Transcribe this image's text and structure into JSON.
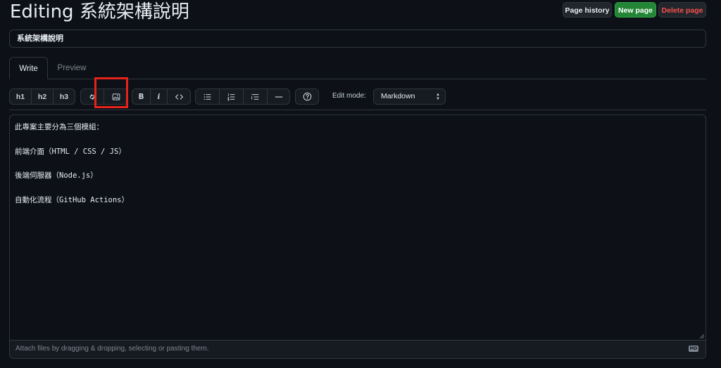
{
  "page": {
    "title": "Editing 系統架構說明"
  },
  "header_buttons": {
    "history": "Page history",
    "new": "New page",
    "delete": "Delete page"
  },
  "title_input": {
    "value": "系統架構說明"
  },
  "tabs": {
    "write": "Write",
    "preview": "Preview"
  },
  "toolbar": {
    "h1": "h1",
    "h2": "h2",
    "h3": "h3",
    "bold": "B",
    "italic": "i",
    "icons": [
      "link-icon",
      "image-icon",
      "code-icon",
      "unordered-list-icon",
      "ordered-list-icon",
      "task-list-icon",
      "horizontal-rule-icon",
      "help-icon"
    ]
  },
  "edit_mode": {
    "label": "Edit mode:",
    "selected": "Markdown"
  },
  "editor": {
    "lines": [
      "此專案主要分為三個模組：",
      "",
      "前端介面（HTML / CSS / JS）",
      "",
      "後端伺服器（Node.js）",
      "",
      "自動化流程（GitHub Actions）"
    ],
    "attach_hint": "Attach files by dragging & dropping, selecting or pasting them.",
    "md_badge": "MD"
  },
  "colors": {
    "accent_highlight": "#e5231b",
    "primary_button": "#238636",
    "danger_text": "#f85149"
  }
}
